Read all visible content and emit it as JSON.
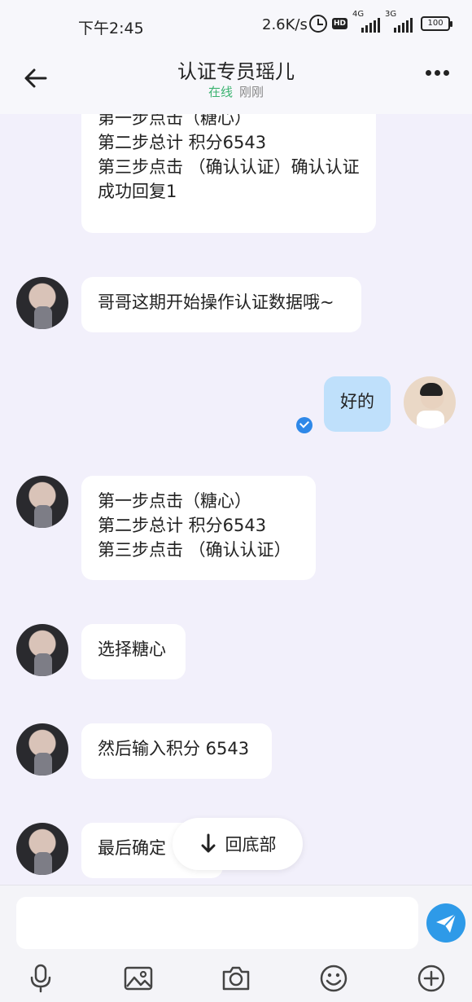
{
  "status_bar": {
    "time": "下午2:45",
    "net_speed": "2.6K/s",
    "hd": "HD",
    "net1": "4G",
    "net2": "3G",
    "battery": "100"
  },
  "header": {
    "title": "认证专员瑶儿",
    "status": "在线",
    "last_seen": "刚刚"
  },
  "messages": [
    {
      "from": "her",
      "text": "第一步点击（糖心）\n第二步总计  积分6543\n第三步点击 （确认认证）确认认证成功回复1"
    },
    {
      "from": "her",
      "text": "哥哥这期开始操作认证数据哦~"
    },
    {
      "from": "me",
      "text": "好的"
    },
    {
      "from": "her",
      "text": "第一步点击（糖心）\n第二步总计  积分6543\n第三步点击 （确认认证）"
    },
    {
      "from": "her",
      "text": "选择糖心"
    },
    {
      "from": "her",
      "text": "然后输入积分 6543"
    },
    {
      "from": "her",
      "text": "最后确定"
    }
  ],
  "scroll_to_bottom_label": "回底部",
  "composer": {
    "placeholder": "",
    "tools": [
      "microphone-icon",
      "image-icon",
      "camera-icon",
      "emoji-icon",
      "plus-icon"
    ],
    "send_icon": "send-icon",
    "send_color": "#2e9ae8"
  },
  "colors": {
    "chat_bg": "#f2f0fb",
    "my_bubble": "#bfe0fb",
    "online": "#3cb371"
  }
}
